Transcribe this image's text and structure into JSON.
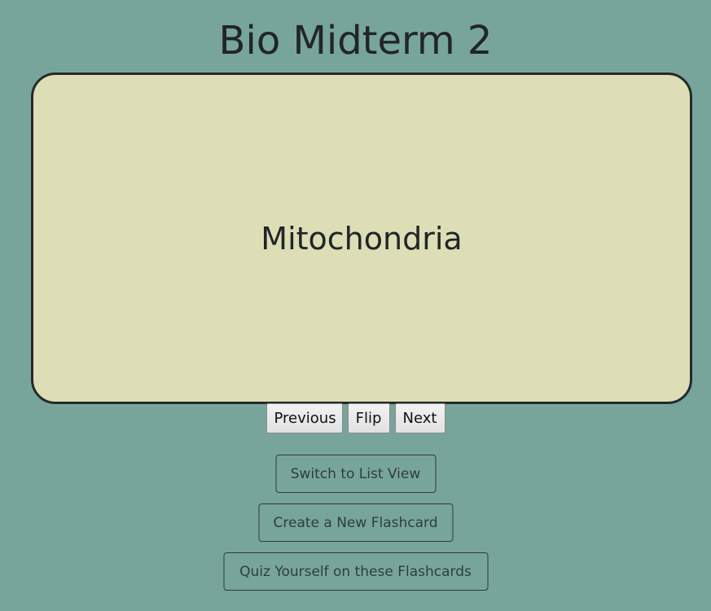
{
  "page": {
    "title": "Bio Midterm 2"
  },
  "card": {
    "term": "Mitochondria"
  },
  "controls": {
    "previous_label": "Previous",
    "flip_label": "Flip",
    "next_label": "Next"
  },
  "actions": {
    "list_view_label": "Switch to List View",
    "create_label": "Create a New Flashcard",
    "quiz_label": "Quiz Yourself on these Flashcards"
  },
  "colors": {
    "background": "#78a59b",
    "card_background": "#dddeb5",
    "card_border": "#252a2c",
    "text": "#212529"
  }
}
